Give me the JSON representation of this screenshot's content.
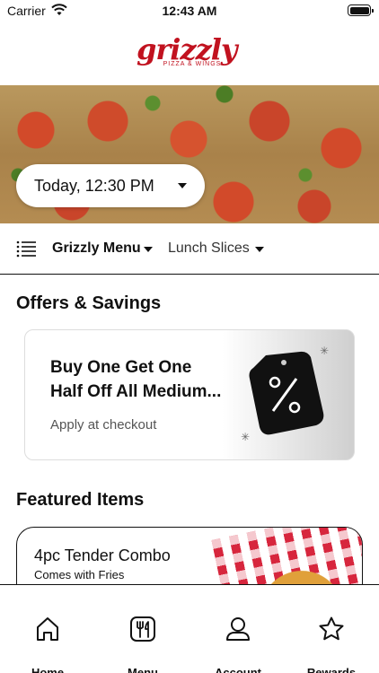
{
  "status_bar": {
    "carrier": "Carrier",
    "time": "12:43 AM"
  },
  "brand": {
    "name": "grizzly",
    "tagline": "PIZZA & WINGS",
    "color": "#c1121f"
  },
  "order_time": {
    "label": "Today, 12:30 PM"
  },
  "menu_bar": {
    "menu_label": "Grizzly Menu",
    "category_label": "Lunch Slices"
  },
  "offers": {
    "title": "Offers & Savings",
    "card": {
      "line1": "Buy One Get One",
      "line2": "Half Off All Medium...",
      "subtitle": "Apply at checkout",
      "icon": "percent-tag-icon"
    }
  },
  "featured": {
    "title": "Featured Items",
    "items": [
      {
        "name": "4pc Tender Combo",
        "description": "Comes with Fries"
      }
    ]
  },
  "tabs": [
    {
      "label": "Home",
      "icon": "home-icon"
    },
    {
      "label": "Menu",
      "icon": "menu-utensils-icon"
    },
    {
      "label": "Account",
      "icon": "user-icon"
    },
    {
      "label": "Rewards",
      "icon": "star-icon"
    }
  ]
}
